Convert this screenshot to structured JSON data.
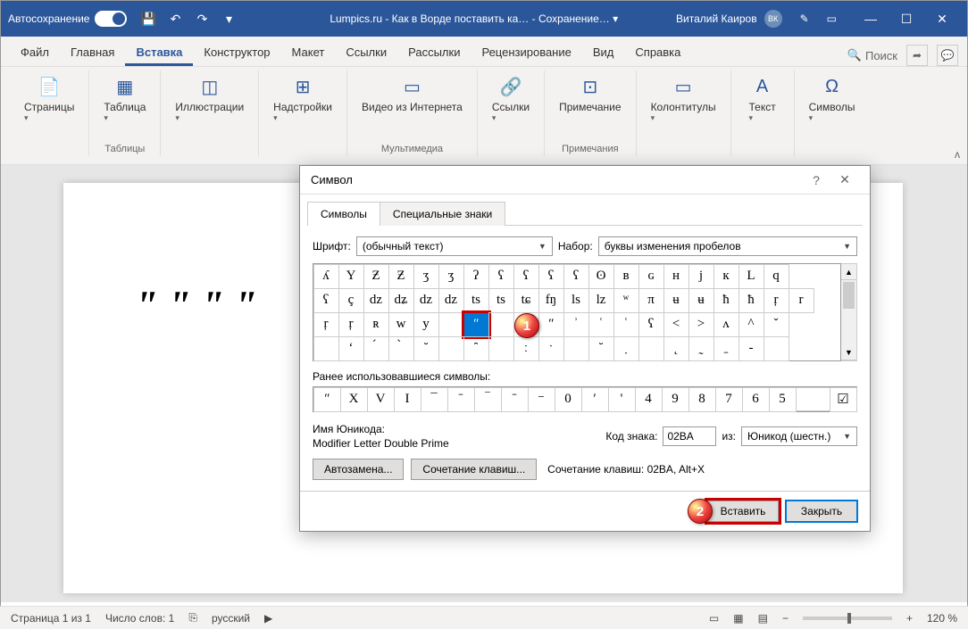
{
  "titlebar": {
    "autosave": "Автосохранение",
    "title": "Lumpics.ru - Как в Ворде поставить ка… - Сохранение… ▾",
    "user": "Виталий Каиров",
    "avatar": "ВК"
  },
  "tabs": [
    "Файл",
    "Главная",
    "Вставка",
    "Конструктор",
    "Макет",
    "Ссылки",
    "Рассылки",
    "Рецензирование",
    "Вид",
    "Справка"
  ],
  "active_tab": 2,
  "search": "Поиск",
  "ribbon": {
    "groups": [
      {
        "items": [
          {
            "icon": "📄",
            "label": "Страницы",
            "caret": true
          }
        ],
        "label": ""
      },
      {
        "items": [
          {
            "icon": "▦",
            "label": "Таблица",
            "caret": true
          }
        ],
        "label": "Таблицы"
      },
      {
        "items": [
          {
            "icon": "◫",
            "label": "Иллюстрации",
            "caret": true
          }
        ],
        "label": ""
      },
      {
        "items": [
          {
            "icon": "⊞",
            "label": "Надстройки",
            "caret": true
          }
        ],
        "label": ""
      },
      {
        "items": [
          {
            "icon": "▭",
            "label": "Видео из Интернета"
          }
        ],
        "label": "Мультимедиа"
      },
      {
        "items": [
          {
            "icon": "🔗",
            "label": "Ссылки",
            "caret": true
          }
        ],
        "label": ""
      },
      {
        "items": [
          {
            "icon": "⊡",
            "label": "Примечание"
          }
        ],
        "label": "Примечания"
      },
      {
        "items": [
          {
            "icon": "▭",
            "label": "Колонтитулы",
            "caret": true
          }
        ],
        "label": ""
      },
      {
        "items": [
          {
            "icon": "A",
            "label": "Текст",
            "caret": true
          }
        ],
        "label": ""
      },
      {
        "items": [
          {
            "icon": "Ω",
            "label": "Символы",
            "caret": true
          }
        ],
        "label": ""
      }
    ]
  },
  "doc_text": "ʺ ʺ ʺ ʺ",
  "dialog": {
    "title": "Символ",
    "tabs": [
      "Символы",
      "Специальные знаки"
    ],
    "font_label": "Шрифт:",
    "font_value": "(обычный текст)",
    "set_label": "Набор:",
    "set_value": "буквы изменения пробелов",
    "grid": [
      [
        "ʎ",
        "Y",
        "Ƶ",
        "Ƶ",
        "ʒ",
        "ʒ",
        "ʔ",
        "ʕ",
        "ʕ",
        "ʕ",
        "ʕ",
        "ʘ",
        "в",
        "ɢ",
        "ʜ",
        "j",
        "к",
        "L",
        "q"
      ],
      [
        "ʕ",
        "ç",
        "dz",
        "dʑ",
        "dz",
        "dz",
        "ts",
        "ts",
        "tɕ",
        "fŋ",
        "ls",
        "lz",
        "ʷ",
        "π",
        "ʉ",
        "ʉ",
        "ħ",
        "ħ",
        "ŗ",
        "r"
      ],
      [
        "ŗ",
        "ŗ",
        "ʀ",
        "w",
        "y",
        "",
        "ʺ",
        "",
        "ʹ",
        "ʺ",
        "ʾ",
        "ʿ",
        "ʿ",
        "ʕ",
        "<",
        ">",
        "ʌ",
        "^",
        "ˇ"
      ],
      [
        "",
        "ʻ",
        "́",
        "̀",
        "̆",
        "",
        "̑",
        "",
        "ː",
        "ˑ",
        "",
        "˘",
        "̣",
        "",
        "̨",
        "̰",
        "̱",
        "-",
        ""
      ]
    ],
    "sel_row": 2,
    "sel_col": 6,
    "recent_label": "Ранее использовавшиеся символы:",
    "recent": [
      "ʺ",
      "X",
      "V",
      "I",
      "¯",
      "ˉ",
      "‾",
      "ˉ",
      "⁻",
      "0",
      "ʹ",
      "'",
      "4",
      "9",
      "8",
      "7",
      "6",
      "5"
    ],
    "check": "☑",
    "unicode_name_label": "Имя Юникода:",
    "unicode_name": "Modifier Letter Double Prime",
    "code_label": "Код знака:",
    "code_value": "02BA",
    "from_label": "из:",
    "from_value": "Юникод (шестн.)",
    "btn_auto": "Автозамена...",
    "btn_shortcut": "Сочетание клавиш...",
    "shortcut_text": "Сочетание клавиш: 02BA, Alt+X",
    "btn_insert": "Вставить",
    "btn_close": "Закрыть"
  },
  "status": {
    "page": "Страница 1 из 1",
    "words": "Число слов: 1",
    "lang": "русский",
    "zoom": "120 %"
  },
  "callouts": {
    "c1": "1",
    "c2": "2"
  }
}
